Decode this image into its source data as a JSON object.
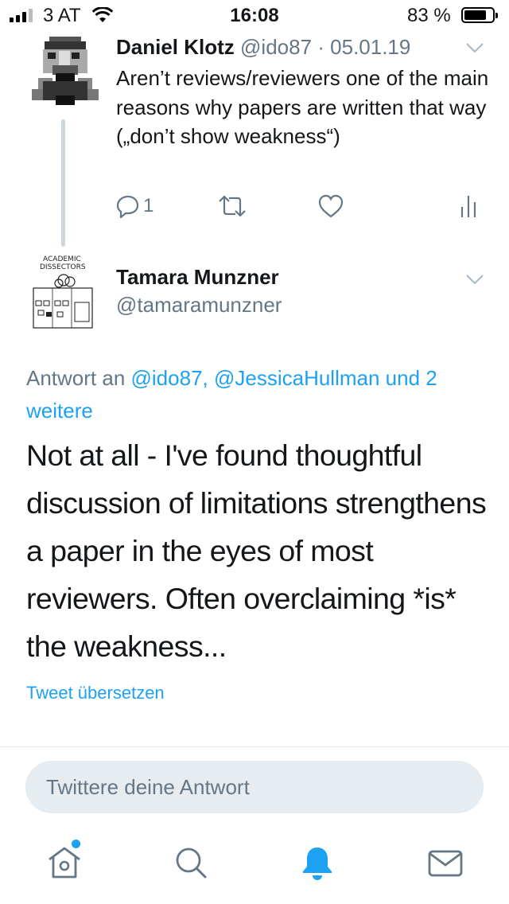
{
  "status_bar": {
    "carrier": "3 AT",
    "time": "16:08",
    "battery": "83 %",
    "battery_level": 0.83,
    "signal_bars": 3
  },
  "parent_tweet": {
    "author_name": "Daniel Klotz",
    "handle_date": "@ido87 · 05.01.19",
    "text": "Aren’t reviews/reviewers one of the main reasons why papers are written that way („don’t show weakness“)",
    "reply_count": "1",
    "icons": [
      "reply-icon",
      "retweet-icon",
      "like-icon",
      "analytics-icon"
    ]
  },
  "reply_tweet": {
    "author_name": "Tamara Munzner",
    "handle": "@tamaramunzner",
    "reply_to_prefix": "Antwort an ",
    "reply_to_mentions": "@ido87, @JessicaHullman und 2 weitere",
    "text": "Not at all - I've found thoughtful discussion of limitations strengthens a paper in the eyes of most reviewers. Often overclaiming *is* the weakness...",
    "translate": "Tweet übersetzen"
  },
  "compose": {
    "placeholder": "Twittere deine Antwort"
  },
  "tab_bar": {
    "tabs": [
      "home-icon",
      "search-icon",
      "notifications-icon",
      "messages-icon"
    ],
    "active": "notifications-icon"
  },
  "colors": {
    "accent": "#1da1f2",
    "secondary_text": "#657786",
    "divider": "#e1e8ed",
    "input_bg": "#e6ecf0"
  }
}
